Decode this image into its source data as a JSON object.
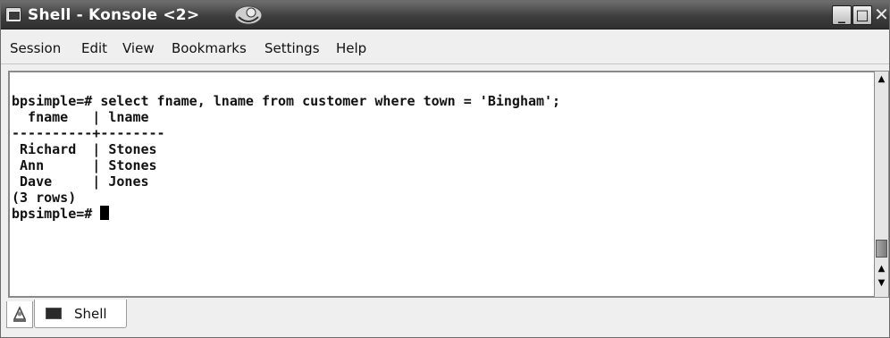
{
  "window": {
    "title": "Shell - Konsole <2>"
  },
  "menubar": {
    "items": [
      "Session",
      "Edit",
      "View",
      "Bookmarks",
      "Settings",
      "Help"
    ]
  },
  "terminal": {
    "lines": [
      "bpsimple=# select fname, lname from customer where town = 'Bingham';",
      "  fname   | lname",
      "----------+--------",
      " Richard  | Stones",
      " Ann      | Stones",
      " Dave     | Jones",
      "(3 rows)",
      "",
      "bpsimple=# "
    ]
  },
  "tabs": [
    {
      "label": "Shell"
    }
  ],
  "colors": {
    "titlebar": "#3e3e3e",
    "terminal_bg": "#ffffff",
    "terminal_fg": "#111111"
  }
}
